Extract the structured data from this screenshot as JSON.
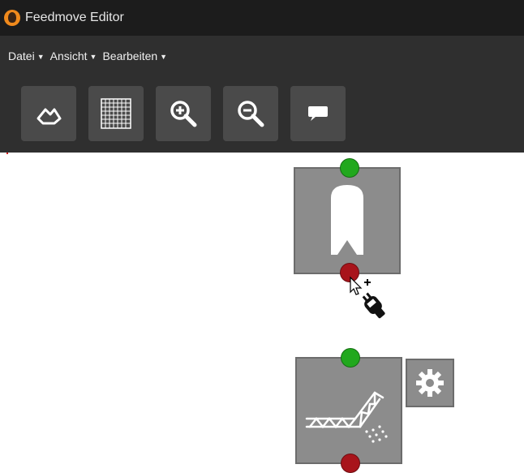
{
  "window": {
    "title": "Feedmove Editor",
    "logo_icon": "feedmove-logo-icon"
  },
  "menu": {
    "items": [
      {
        "label": "Datei"
      },
      {
        "label": "Ansicht"
      },
      {
        "label": "Bearbeiten"
      }
    ]
  },
  "toolbar": {
    "buttons": [
      {
        "icon": "home-icon"
      },
      {
        "icon": "grid-icon"
      },
      {
        "icon": "zoom-in-icon"
      },
      {
        "icon": "zoom-out-icon"
      },
      {
        "icon": "comment-icon"
      }
    ]
  },
  "canvas": {
    "nodes": [
      {
        "icon": "silo-icon",
        "ports": [
          "input",
          "output"
        ]
      },
      {
        "icon": "conveyor-icon",
        "ports": [
          "input",
          "output"
        ],
        "has_settings": true
      }
    ],
    "cursor": "connect-plug-cursor"
  },
  "colors": {
    "title_bg": "#1c1c1c",
    "menu_bg": "#2f2f2f",
    "button_bg": "#4a4a4a",
    "node_bg": "#8c8c8c",
    "port_input": "#21a81d",
    "port_output": "#a8141b"
  }
}
